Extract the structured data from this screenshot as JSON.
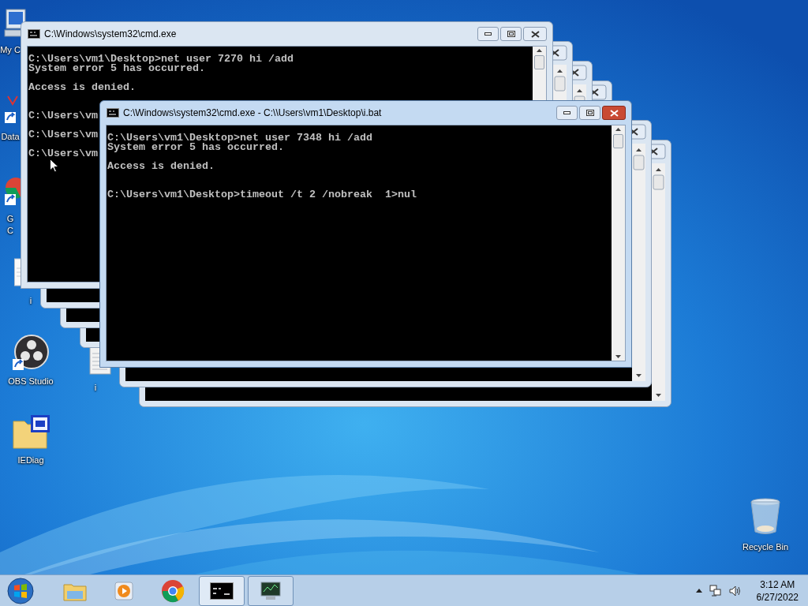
{
  "desktop_icons": [
    {
      "kind": "computer",
      "label": "My C"
    },
    {
      "kind": "data",
      "label": "Data"
    },
    {
      "kind": "chrome",
      "label": "G\nC"
    },
    {
      "kind": "document",
      "label": "i"
    },
    {
      "kind": "obs",
      "label": "OBS Studio"
    },
    {
      "kind": "batch",
      "label": "i"
    },
    {
      "kind": "folder",
      "label": "IEDiag"
    },
    {
      "kind": "recycle",
      "label": "Recycle Bin"
    }
  ],
  "windows": [
    {
      "kind": "covered",
      "active": false
    },
    {
      "kind": "covered",
      "active": false
    },
    {
      "kind": "covered",
      "active": false
    },
    {
      "kind": "covered",
      "active": false
    },
    {
      "kind": "covered",
      "active": false
    },
    {
      "kind": "console",
      "active": false,
      "title": "C:\\Windows\\system32\\cmd.exe",
      "output": "C:\\Users\\vm1\\Desktop>net user 7270 hi /add\nSystem error 5 has occurred.\n\nAccess is denied.\n\n\nC:\\Users\\vm\n\nC:\\Users\\vm\n\nC:\\Users\\vm"
    },
    {
      "kind": "console",
      "active": true,
      "title": "C:\\Windows\\system32\\cmd.exe - C:\\\\Users\\vm1\\Desktop\\i.bat",
      "output": "C:\\Users\\vm1\\Desktop>net user 7348 hi /add\nSystem error 5 has occurred.\n\nAccess is denied.\n\n\nC:\\Users\\vm1\\Desktop>timeout /t 2 /nobreak  1>nul"
    }
  ],
  "taskbar": {
    "items": [
      {
        "kind": "explorer",
        "selected": false,
        "running": false
      },
      {
        "kind": "media",
        "selected": false,
        "running": false
      },
      {
        "kind": "chrome",
        "selected": false,
        "running": false
      },
      {
        "kind": "cmd",
        "selected": true,
        "running": true
      },
      {
        "kind": "monitor",
        "selected": false,
        "running": true
      }
    ],
    "time": "3:12 AM",
    "date": "6/27/2022"
  }
}
